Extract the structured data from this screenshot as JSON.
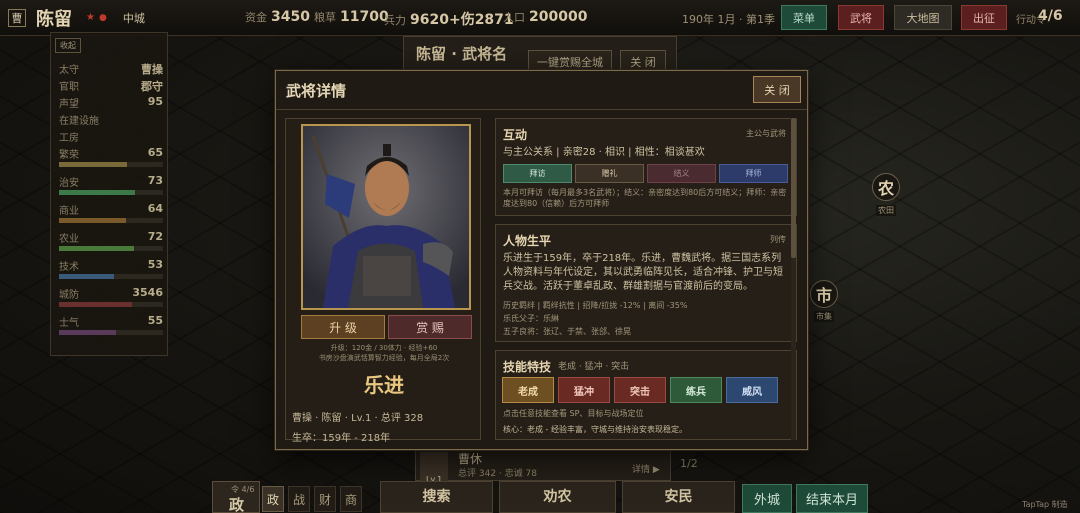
{
  "topbar": {
    "city_icon": "曹",
    "city_name": "陈留",
    "city_rank": "中城",
    "resources": [
      {
        "label": "资金",
        "value": "3450"
      },
      {
        "label": "粮草",
        "value": "11700"
      },
      {
        "label": "兵力",
        "value": "9620+伤2871"
      },
      {
        "label": "人口",
        "value": "200000"
      }
    ],
    "date": "190年 1月 · 第1季",
    "buttons": [
      "菜单",
      "武将",
      "大地图",
      "出征"
    ],
    "ap_label": "行动令",
    "ap_value": "4/6"
  },
  "left_panel": {
    "collapse": "收起",
    "rows": [
      {
        "label": "太守",
        "value": "曹操"
      },
      {
        "label": "官职",
        "value": "郡守"
      },
      {
        "label": "声望",
        "value": "95"
      },
      {
        "label": "在建设施",
        "value": ""
      },
      {
        "label": "工房",
        "value": ""
      },
      {
        "label": "繁荣",
        "value": "65",
        "bar": 0.65,
        "color": "#7a6a3a"
      },
      {
        "label": "治安",
        "value": "73",
        "bar": 0.73,
        "color": "#3d7a4a"
      },
      {
        "label": "商业",
        "value": "64",
        "bar": 0.64,
        "color": "#7a5a2a"
      },
      {
        "label": "农业",
        "value": "72",
        "bar": 0.72,
        "color": "#4a7a3a"
      },
      {
        "label": "技术",
        "value": "53",
        "bar": 0.53,
        "color": "#3a5a7a"
      },
      {
        "label": "城防",
        "value": "3546",
        "bar": 0.7,
        "color": "#6a3030"
      },
      {
        "label": "士气",
        "value": "55",
        "bar": 0.55,
        "color": "#5a3a5a"
      }
    ]
  },
  "behind_card": {
    "title": "陈留 · 武将名",
    "reward_all": "一键赏赐全城",
    "close": "关 闭"
  },
  "map_badges": [
    {
      "char": "农",
      "sub": "农田"
    },
    {
      "char": "市",
      "sub": "市集"
    }
  ],
  "peek": {
    "name": "曹休",
    "lv": "Lv.1",
    "meta": "总评 342 · 忠诚 78",
    "detail": "详情 ▶",
    "side": "1/2"
  },
  "modal": {
    "title": "武将详情",
    "close": "关 闭",
    "left": {
      "upgrade": "升 级",
      "reward": "赏 赐",
      "upgrade_note1": "升级：120金 / 30体力 · 经验+60",
      "upgrade_note2": "书房沙盘演武恬算智力经验，每月全局2次",
      "name": "乐进",
      "meta": "曹操 · 陈留 · Lv.1 · 总评 328",
      "life": "生卒：159年 - 218年"
    },
    "interaction": {
      "title": "互动",
      "tag": "主公与武将",
      "relation": "与主公关系 | 亲密28 · 相识 | 相性：相谈甚欢",
      "buttons": [
        "拜访",
        "赠礼",
        "结义",
        "拜师"
      ],
      "note": "本月可拜访（每月最多3名武将）；结义：亲密度达到80后方可结义；拜师：亲密度达到80（信赖）后方可拜师"
    },
    "biography": {
      "title": "人物生平",
      "tag": "列传",
      "text": "乐进生于159年，卒于218年。乐进，曹魏武将。据三国志系列人物资料与年代设定，其以武勇临阵见长，适合冲锋、护卫与短兵交战。活跃于董卓乱政、群雄割据与官渡前后的变局。",
      "trait1": "历史羁绊 | 羁绊抗性 | 招降/拉拢 -12% | 离间 -35%",
      "trait2": "乐氏父子：乐綝",
      "trait3": "五子良将：张辽、于禁、张郃、徐晃"
    },
    "skills": {
      "title": "技能特技",
      "summary": "老成 · 猛冲 · 突击",
      "buttons": [
        "老成",
        "猛冲",
        "突击",
        "练兵",
        "威风"
      ],
      "hint": "点击任意技能查看 SP、目标与战场定位",
      "core": "核心：老成 - 经验丰富，守城与维持治安表现稳定。"
    }
  },
  "bottom": {
    "main_count": "令 4/6",
    "main_label": "政",
    "tabs": [
      "政",
      "战",
      "财",
      "商"
    ],
    "cards": [
      "搜索",
      "劝农",
      "安民"
    ],
    "foreign": "外城",
    "end_month": "结束本月",
    "watermark": "TapTap 制造"
  }
}
